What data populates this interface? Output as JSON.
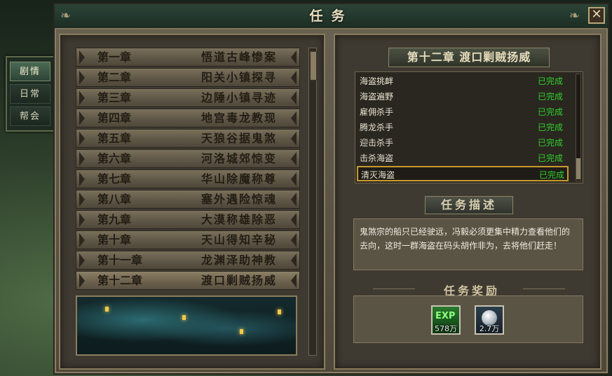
{
  "side_tabs": [
    "剧情",
    "日常",
    "帮会"
  ],
  "window": {
    "title": "任务",
    "close_glyph": "✕"
  },
  "chapters": [
    {
      "num": "第一章",
      "name": "悟道古峰惨案"
    },
    {
      "num": "第二章",
      "name": "阳关小镇探寻"
    },
    {
      "num": "第三章",
      "name": "边陲小镇寻迹"
    },
    {
      "num": "第四章",
      "name": "地宫毒龙教现"
    },
    {
      "num": "第五章",
      "name": "天狼谷据鬼煞"
    },
    {
      "num": "第六章",
      "name": "河洛城郊惊变"
    },
    {
      "num": "第七章",
      "name": "华山除魔称尊"
    },
    {
      "num": "第八章",
      "name": "塞外遇险惊魂"
    },
    {
      "num": "第九章",
      "name": "大漠称雄除恶"
    },
    {
      "num": "第十章",
      "name": "天山得知辛秘"
    },
    {
      "num": "第十一章",
      "name": "龙渊泽助神教"
    },
    {
      "num": "第十二章",
      "name": "渡口剿贼扬威"
    }
  ],
  "right": {
    "chapter_banner": "第十二章  渡口剿贼扬威",
    "quests": [
      {
        "name": "海盗挑衅",
        "status": "已完成"
      },
      {
        "name": "海盗遍野",
        "status": "已完成"
      },
      {
        "name": "雇佣杀手",
        "status": "已完成"
      },
      {
        "name": "腾龙杀手",
        "status": "已完成"
      },
      {
        "name": "迎击杀手",
        "status": "已完成"
      },
      {
        "name": "击杀海盗",
        "status": "已完成"
      },
      {
        "name": "清灭海盗",
        "status": "已完成"
      }
    ],
    "description_title": "任务描述",
    "description_text": "鬼煞宗的船只已经驶远，冯毅必须更集中精力查看他们的去向，这时一群海盗在码头胡作非为，去将他们赶走！",
    "reward_title": "任务奖励",
    "rewards": [
      {
        "icon": "exp-icon",
        "label": "EXP",
        "amount": "578万"
      },
      {
        "icon": "silver-coin-icon",
        "amount": "2.7万"
      }
    ]
  },
  "colors": {
    "completed": "#2fd12d",
    "selected_border": "#c69a2e",
    "title_text": "#e9dfc0"
  }
}
